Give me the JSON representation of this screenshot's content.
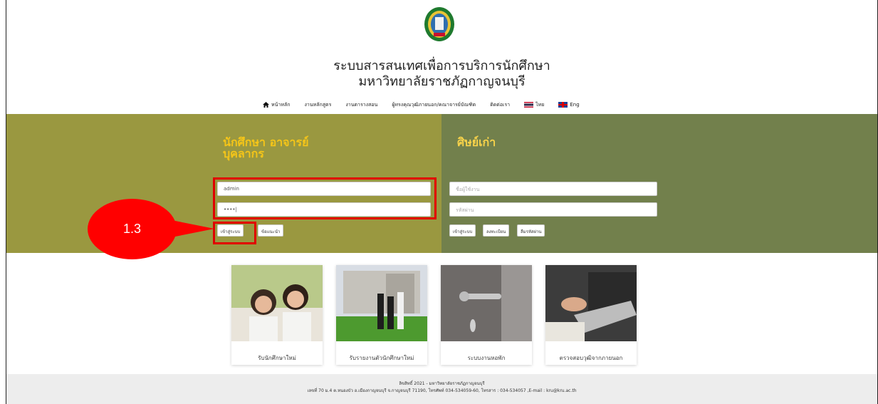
{
  "header": {
    "title_line1": "ระบบสารสนเทศเพื่อการบริการนักศึกษา",
    "title_line2": "มหาวิทยาลัยราชภัฏกาญจนบุรี"
  },
  "nav": {
    "items": [
      {
        "label": "หน้าหลัก",
        "icon": "home-icon"
      },
      {
        "label": "งานหลักสูตร"
      },
      {
        "label": "งานตารางสอน"
      },
      {
        "label": "ผู้ทรงคุณวุฒิภายนอก/คณาจารย์บัณฑิต"
      },
      {
        "label": "ติดต่อเรา"
      },
      {
        "label": "ไทย",
        "icon": "thai-flag-icon"
      },
      {
        "label": "Eng",
        "icon": "uk-flag-icon"
      }
    ]
  },
  "left_panel": {
    "title_line1": "นักศึกษา อาจารย์",
    "title_line2": "บุคลากร",
    "username_value": "admin",
    "password_value": "••••|",
    "login_button": "เข้าสู่ระบบ",
    "guide_button": "ข้อแนะนำ",
    "color": "#9a9840"
  },
  "right_panel": {
    "title": "ศิษย์เก่า",
    "username_placeholder": "ชื่อผู้ใช้งาน",
    "password_placeholder": "รหัสผ่าน",
    "login_button": "เข้าสู่ระบบ",
    "register_button": "ลงทะเบียน",
    "forgot_button": "ลืมรหัสผ่าน",
    "color": "#72804c"
  },
  "annotation": {
    "label": "1.3",
    "color": "#ff0000"
  },
  "cards": [
    {
      "label": "รับนักศึกษาใหม่"
    },
    {
      "label": "รับรายงานตัวนักศึกษาใหม่"
    },
    {
      "label": "ระบบงานหอพัก"
    },
    {
      "label": "ตรวจสอบวุฒิจากภายนอก"
    }
  ],
  "footer": {
    "line1": "ลิขสิทธิ์ 2021 - มหาวิทยาลัยราชภัฏกาญจนบุรี",
    "line2": "เลขที่ 70 ม.4 ต.หนองบัว อ.เมืองกาญจนบุรี จ.กาญจนบุรี 71190, โทรศัพท์ 034-534059-60, โทรสาร : 034-534057 ,E-mail : kru@kru.ac.th"
  }
}
